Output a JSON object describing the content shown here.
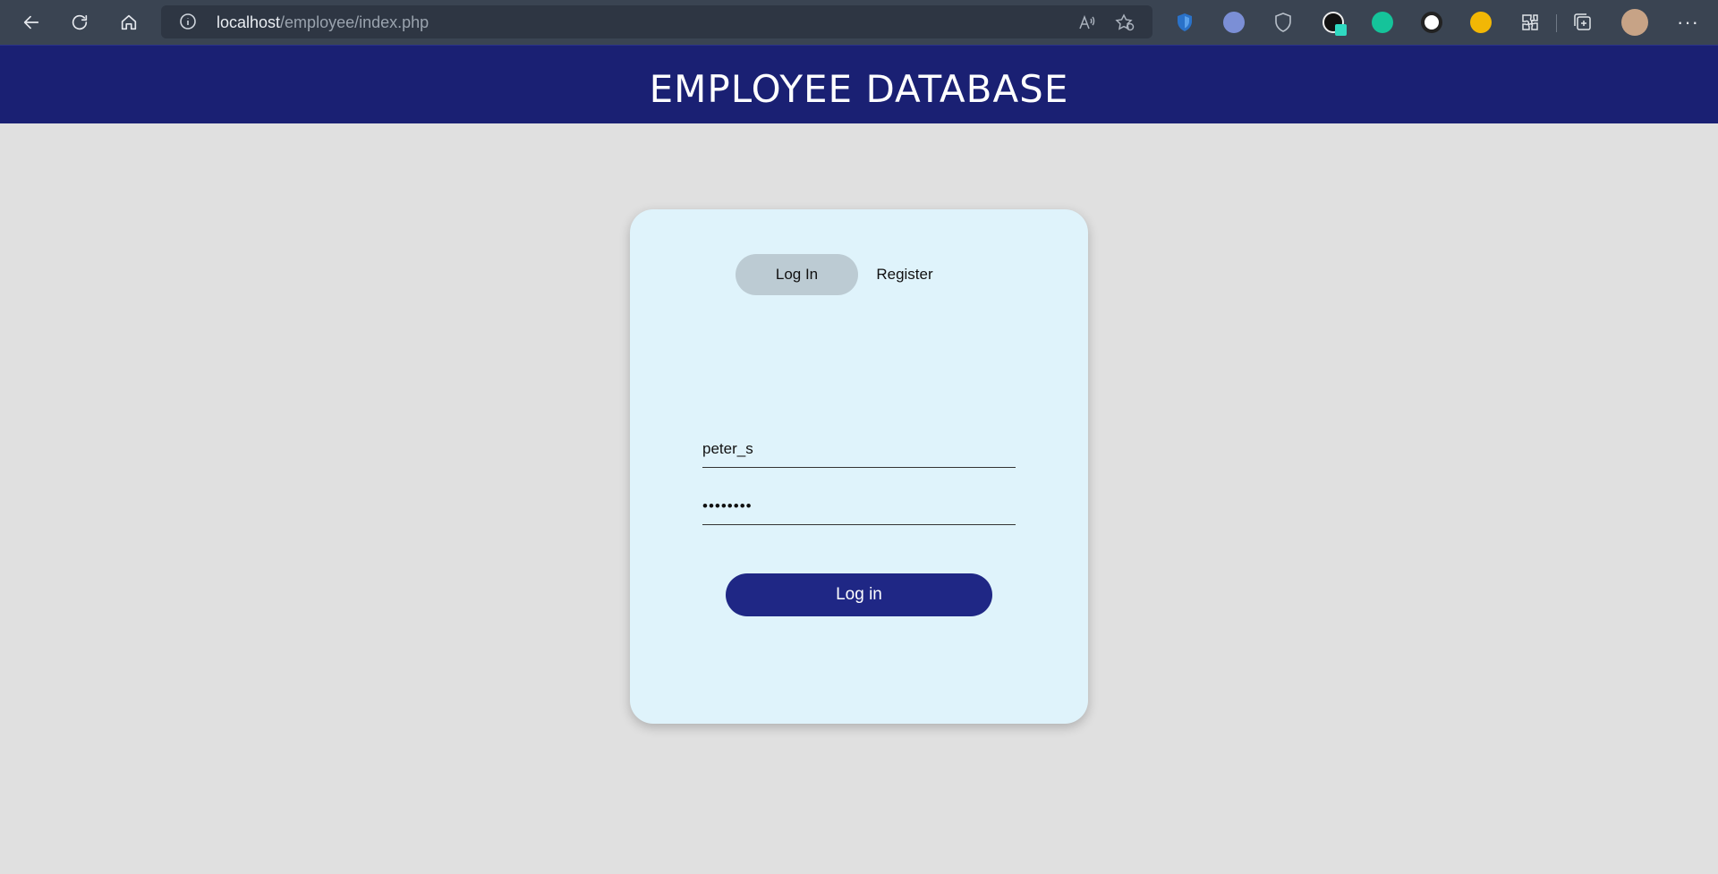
{
  "browser": {
    "url_host": "localhost",
    "url_path": "/employee/index.php",
    "icons": [
      "back-arrow-icon",
      "refresh-icon",
      "home-icon",
      "info-icon",
      "read-aloud-icon",
      "favorites-add-icon",
      "menu-dots-icon"
    ],
    "menu_dots": "···"
  },
  "header": {
    "title": "EMPLOYEE DATABASE",
    "background": "#1a2073"
  },
  "login_card": {
    "tabs": [
      {
        "label": "Log In",
        "active": true
      },
      {
        "label": "Register",
        "active": false
      }
    ],
    "username_value": "peter_s",
    "password_value": "••••••••",
    "submit_label": "Log in",
    "accent": "#1f2785"
  }
}
